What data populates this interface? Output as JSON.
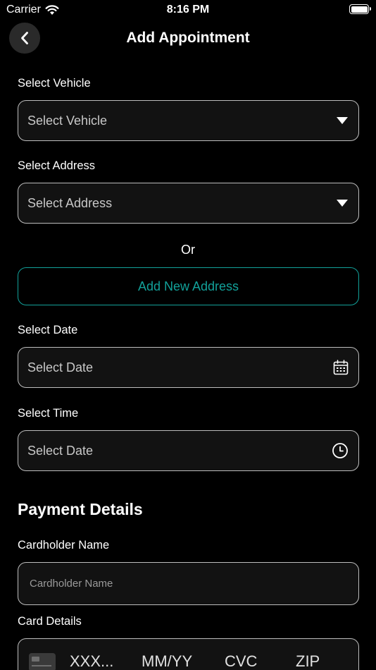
{
  "status": {
    "carrier": "Carrier",
    "time": "8:16 PM"
  },
  "nav": {
    "title": "Add Appointment"
  },
  "form": {
    "vehicle": {
      "label": "Select Vehicle",
      "placeholder": "Select Vehicle"
    },
    "address": {
      "label": "Select Address",
      "placeholder": "Select Address"
    },
    "or_text": "Or",
    "add_address_label": "Add New Address",
    "date": {
      "label": "Select Date",
      "placeholder": "Select Date"
    },
    "time": {
      "label": "Select Time",
      "placeholder": "Select Date"
    }
  },
  "payment": {
    "title": "Payment Details",
    "cardholder_label": "Cardholder Name",
    "cardholder_placeholder": "Cardholder Name",
    "card_details_label": "Card Details",
    "card_number_placeholder": "XXX...",
    "expiry_placeholder": "MM/YY",
    "cvc_placeholder": "CVC",
    "zip_placeholder": "ZIP"
  },
  "colors": {
    "accent": "#12a19a",
    "background": "#000000",
    "field_bg": "#121212"
  },
  "icons": {
    "back": "chevron-left-icon",
    "dropdown": "caret-down-icon",
    "calendar": "calendar-icon",
    "clock": "clock-icon",
    "card": "credit-card-icon"
  }
}
